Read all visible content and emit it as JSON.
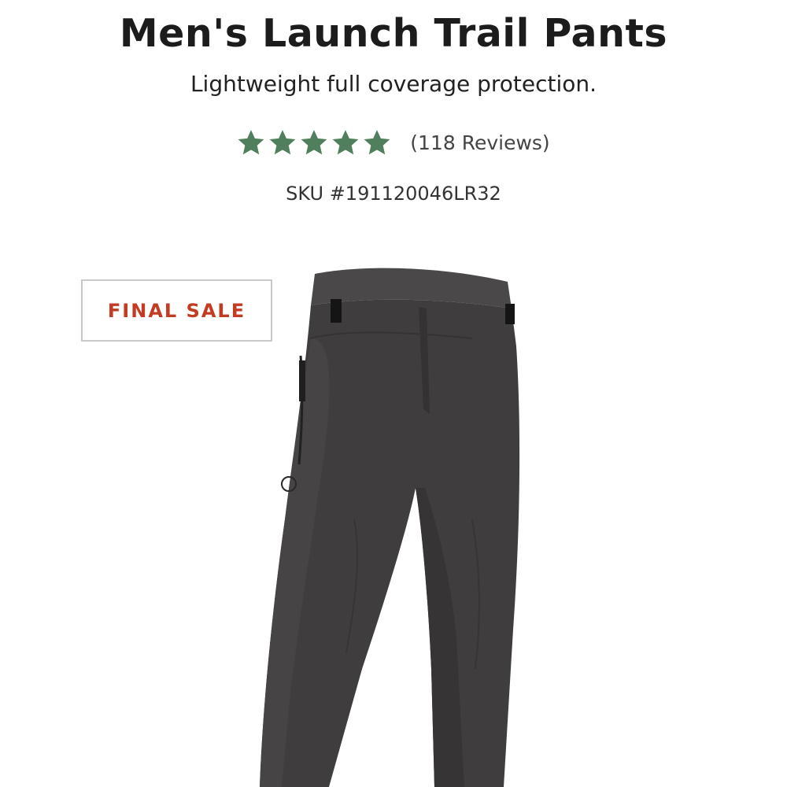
{
  "product": {
    "title": "Men's Launch Trail Pants",
    "subtitle": "Lightweight full coverage protection.",
    "rating": 5,
    "rating_max": 5,
    "reviews_label": "(118 Reviews)",
    "sku_label": "SKU #191120046LR32"
  },
  "badge": {
    "label": "FINAL SALE"
  },
  "colors": {
    "star": "#4f7f5c",
    "badge_text": "#c23b22",
    "pants": "#3f3d3e"
  },
  "icons": {
    "star": "star-icon"
  }
}
